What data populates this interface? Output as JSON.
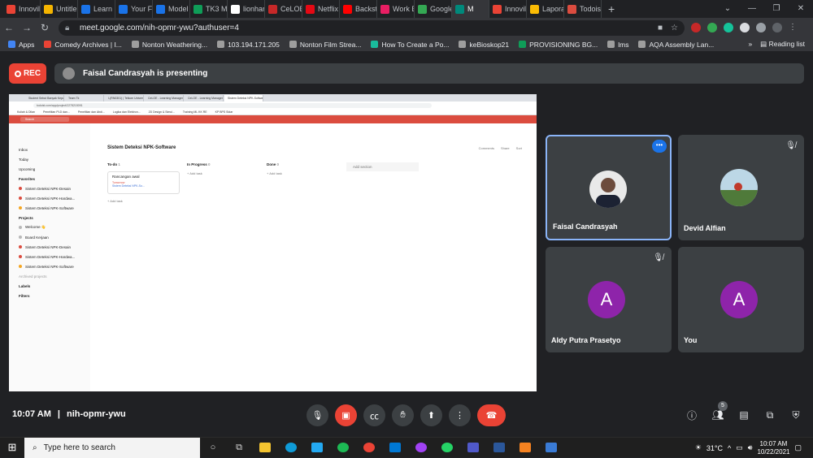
{
  "browser": {
    "tabs": [
      {
        "label": "Innovil",
        "color": "#ea4335"
      },
      {
        "label": "Untitle",
        "color": "#f4b400"
      },
      {
        "label": "Learn i",
        "color": "#1a73e8"
      },
      {
        "label": "Your Fe",
        "color": "#1a73e8"
      },
      {
        "label": "Model",
        "color": "#1a73e8"
      },
      {
        "label": "TK3 Mi",
        "color": "#0f9d58"
      },
      {
        "label": "lionhar",
        "color": "#ffffff"
      },
      {
        "label": "CeLOE",
        "color": "#c62828"
      },
      {
        "label": "Netflix",
        "color": "#e50914"
      },
      {
        "label": "Backst",
        "color": "#ff0000"
      },
      {
        "label": "Work E",
        "color": "#e91e63"
      },
      {
        "label": "Google",
        "color": "#34a853"
      },
      {
        "label": "M",
        "color": "#00897b"
      },
      {
        "label": "Innovil",
        "color": "#ea4335"
      },
      {
        "label": "Lapora",
        "color": "#fbbc04"
      },
      {
        "label": "Todois",
        "color": "#db4c3f"
      }
    ],
    "new_tab": "+",
    "url": "meet.google.com/nih-opmr-ywu?authuser=4",
    "bookmarks": [
      {
        "label": "Apps",
        "color": "#4285f4"
      },
      {
        "label": "Comedy Archives | I...",
        "color": "#ea4335"
      },
      {
        "label": "Nonton Weathering...",
        "color": "#9e9e9e"
      },
      {
        "label": "103.194.171.205",
        "color": "#9e9e9e"
      },
      {
        "label": "Nonton Film Strea...",
        "color": "#9e9e9e"
      },
      {
        "label": "How To Create a Po...",
        "color": "#1abc9c"
      },
      {
        "label": "keBioskop21",
        "color": "#9e9e9e"
      },
      {
        "label": "PROVISIONING BG...",
        "color": "#0f9d58"
      },
      {
        "label": "lms",
        "color": "#9e9e9e"
      },
      {
        "label": "AQA Assembly Lan...",
        "color": "#9e9e9e"
      }
    ],
    "more_bookmarks": "»",
    "reading_list": "Reading list"
  },
  "meet": {
    "rec_label": "REC",
    "presenting_text": "Faisal Candrasyah is presenting",
    "time": "10:07 AM",
    "separator": "|",
    "meeting_code": "nih-opmr-ywu",
    "participant_count": "5",
    "participants": [
      {
        "name": "Faisal Candrasyah",
        "avatar": "photo",
        "speaking": true
      },
      {
        "name": "Devid Alfian",
        "avatar": "photo",
        "muted": true
      },
      {
        "name": "Aldy Putra Prasetyo",
        "avatar": "A",
        "muted": true,
        "color": "#8e24aa"
      },
      {
        "name": "You",
        "avatar": "A",
        "color": "#8e24aa"
      }
    ]
  },
  "shared_screen": {
    "tabs": [
      "Student Sebut Banyak Kepala F...",
      "Team Tk",
      "I-(RN0301) | Telkom University",
      "CeLOE - Learning Management",
      "CeLOE - Learning Management",
      "Sistem Deteksi NPK-Software: To..."
    ],
    "url": "todoist.com/app/project/2278215091",
    "bookmarks": [
      "Kuliah & Dilan",
      "Penelitian PLD dan...",
      "Penelitian dan Abdi...",
      "Logika dan Elektron...",
      "2D Design & Simul...",
      "Training ML KK RE",
      "KP BPS Sidar"
    ],
    "search": "Search",
    "sidebar": {
      "top": [
        "Inbox",
        "Today",
        "Upcoming"
      ],
      "favorites_heading": "Favorites",
      "favorites": [
        "Sistem Deteksi NPK-Desain",
        "Sistem Deteksi NPK-Hardwa...",
        "Sistem Deteksi NPK-Software"
      ],
      "projects_heading": "Projects",
      "projects": [
        "Welcome 👋",
        "Board Kerjaan",
        "Sistem Deteksi NPK-Desain",
        "Sistem Deteksi NPK-Hardwa...",
        "Sistem Deteksi NPK-Software"
      ],
      "archived": "Archived projects",
      "labels": "Labels",
      "filters": "Filters"
    },
    "project_title": "Sistem Deteksi NPK-Software",
    "actions": [
      "Comments",
      "Share",
      "Sort"
    ],
    "columns": [
      {
        "name": "To-do",
        "count": "1"
      },
      {
        "name": "In Progress",
        "count": "0"
      },
      {
        "name": "Done",
        "count": "0"
      }
    ],
    "card": {
      "title": "Rancangan awal",
      "date": "Tomorrow",
      "project": "Sistem Deteksi NPK-So..."
    },
    "add_task": "Add task",
    "add_section": "Add section"
  },
  "taskbar": {
    "search_placeholder": "Type here to search",
    "temperature": "31°C",
    "time": "10:07 AM",
    "date": "10/22/2021"
  }
}
